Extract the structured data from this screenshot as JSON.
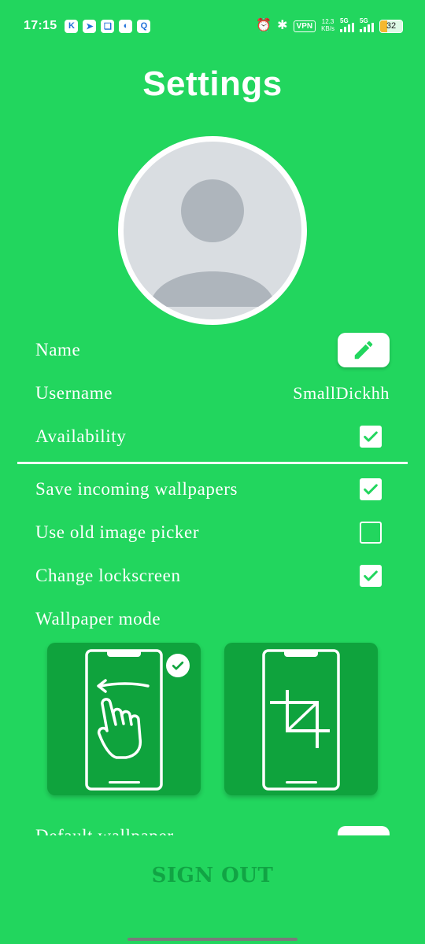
{
  "status_bar": {
    "time": "17:15",
    "app_icons": [
      "K",
      "➤",
      "❏",
      "◐",
      "Q"
    ],
    "vpn": "VPN",
    "net_speed_value": "12.3",
    "net_speed_unit": "KB/s",
    "signal_1": "5G",
    "signal_2": "5G",
    "battery": "32"
  },
  "page": {
    "title": "Settings"
  },
  "rows": {
    "name": "Name",
    "username_label": "Username",
    "username_value": "SmallDickhh",
    "availability": "Availability",
    "save_wallpapers": "Save incoming wallpapers",
    "old_picker": "Use old image picker",
    "change_lockscreen": "Change lockscreen",
    "wallpaper_mode": "Wallpaper mode",
    "default_wallpaper": "Default wallpaper"
  },
  "toggles": {
    "availability": true,
    "save_wallpapers": true,
    "old_picker": false,
    "change_lockscreen": true
  },
  "wallpaper_modes": [
    {
      "icon": "swipe-hand-icon",
      "selected": true
    },
    {
      "icon": "crop-icon",
      "selected": false
    }
  ],
  "footer": {
    "sign_out": "SIGN OUT"
  },
  "colors": {
    "background": "#22d65e",
    "card": "#0fa33d",
    "sign_out": "#11a444"
  }
}
